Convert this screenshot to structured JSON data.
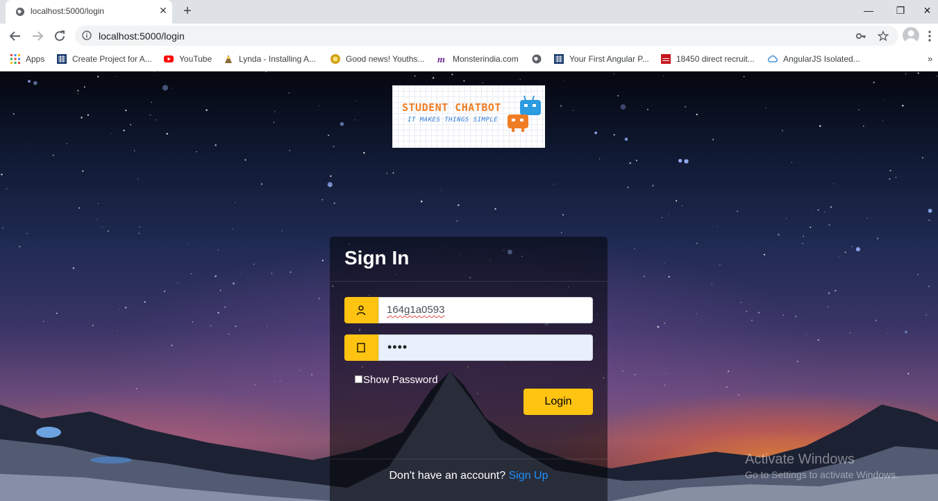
{
  "browser": {
    "tab": {
      "title": "localhost:5000/login",
      "close_glyph": "✕"
    },
    "new_tab_glyph": "+",
    "window_controls": {
      "minimize": "—",
      "maximize": "❐",
      "close": "✕"
    },
    "address": {
      "url": "localhost:5000/login"
    },
    "bookmarks": [
      {
        "label": "Apps",
        "icon": "apps-grid-icon"
      },
      {
        "label": "Create Project for A...",
        "icon": "project-icon"
      },
      {
        "label": "YouTube",
        "icon": "youtube-icon"
      },
      {
        "label": "Lynda - Installing A...",
        "icon": "lynda-icon"
      },
      {
        "label": "Good news! Youths...",
        "icon": "news-icon"
      },
      {
        "label": "Monsterindia.com",
        "icon": "monster-icon"
      },
      {
        "label": "",
        "icon": "globe-icon"
      },
      {
        "label": "Your First Angular P...",
        "icon": "project-icon"
      },
      {
        "label": "18450 direct recruit...",
        "icon": "toi-icon"
      },
      {
        "label": "AngularJS Isolated...",
        "icon": "cloud-icon"
      }
    ],
    "bookmarks_more": "»"
  },
  "logo": {
    "title": "STUDENT CHATBOT",
    "tagline": "IT MAKES THINGS SIMPLE"
  },
  "login": {
    "heading": "Sign In",
    "username_value": "164g1a0593",
    "password_masked": "••••",
    "show_password_label": "Show Password",
    "show_password_checked": false,
    "submit_label": "Login",
    "footer_text": "Don't have an account?",
    "signup_link": "Sign Up"
  },
  "watermark": {
    "line1": "Activate Windows",
    "line2": "Go to Settings to activate Windows."
  },
  "colors": {
    "accent": "#ffc312",
    "link": "#1e90ff",
    "card_bg": "rgba(0,0,0,0.5)"
  }
}
